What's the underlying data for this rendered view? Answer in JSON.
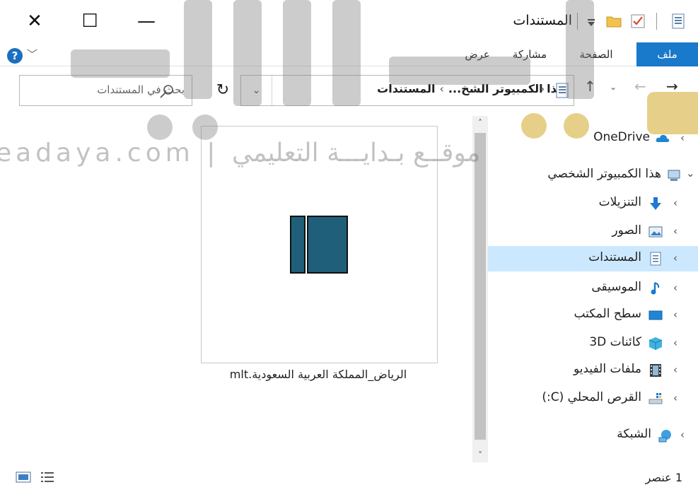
{
  "window": {
    "title": "المستندات",
    "controls": {
      "close": "✕",
      "maximize": "☐",
      "minimize": "—"
    }
  },
  "ribbon": {
    "tabs": {
      "file": "ملف",
      "home": "الصفحة الرئيسية",
      "share": "مشاركة",
      "view": "عرض"
    },
    "help": "?",
    "collapse": "﹀",
    "file_tab_color": "#1979ca"
  },
  "navigation": {
    "back": "→",
    "forward": "←",
    "recent": "⌄",
    "up": "↑",
    "refresh": "↻",
    "dropdown": "⌄"
  },
  "address": {
    "crumbs": [
      "هذا الكمبيوتر الشخ...",
      "المستندات"
    ],
    "separator": "›"
  },
  "search": {
    "placeholder": "بحث في المستندات"
  },
  "files": [
    {
      "name": "الرياض_المملكة العربية السعودية.mlt",
      "icon": "movie-project-icon",
      "icon_color": "#1f5f7a"
    }
  ],
  "scrollbar": {
    "up": "˄",
    "down": "˅"
  },
  "nav_pane": {
    "items": [
      {
        "label": "OneDrive",
        "icon": "cloud-icon",
        "chevron": "‹"
      },
      {
        "label": "هذا الكمبيوتر الشخصي",
        "icon": "computer-icon",
        "chevron": "⌄"
      },
      {
        "label": "التنزيلات",
        "icon": "download-arrow-icon",
        "chevron": "‹"
      },
      {
        "label": "الصور",
        "icon": "pictures-icon",
        "chevron": "‹"
      },
      {
        "label": "المستندات",
        "icon": "documents-icon",
        "chevron": "‹",
        "selected": true
      },
      {
        "label": "الموسيقى",
        "icon": "music-note-icon",
        "chevron": "‹"
      },
      {
        "label": "سطح المكتب",
        "icon": "desktop-icon",
        "chevron": "‹"
      },
      {
        "label": "كائنات 3D",
        "icon": "3d-cube-icon",
        "chevron": "‹"
      },
      {
        "label": "ملفات الفيديو",
        "icon": "film-icon",
        "chevron": "‹"
      },
      {
        "label": "القرص المحلي (C:)",
        "icon": "drive-icon",
        "chevron": "‹"
      },
      {
        "label": "الشبكة",
        "icon": "network-icon",
        "chevron": "‹"
      }
    ],
    "selected_color": "#cce8ff"
  },
  "status": {
    "count": "1 عنصر"
  },
  "watermark": {
    "text": "eadaya.com | موقــع بـدايـــة التعليمي"
  }
}
